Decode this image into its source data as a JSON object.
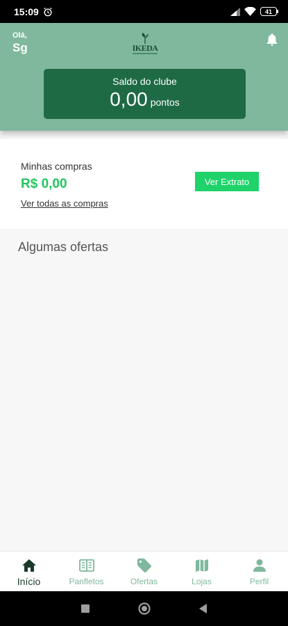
{
  "status_bar": {
    "time": "15:09",
    "battery": "41"
  },
  "header": {
    "greeting": "Olá,",
    "user_name": "Sg",
    "logo_text": "IKEDA",
    "saldo_title": "Saldo do clube",
    "saldo_value": "0,00",
    "saldo_unit": "pontos"
  },
  "purchases": {
    "label": "Minhas compras",
    "amount": "R$ 0,00",
    "see_all": "Ver todas as compras",
    "extrato_button": "Ver Extrato"
  },
  "offers": {
    "title": "Algumas ofertas"
  },
  "bottom_nav": {
    "items": [
      {
        "label": "Início",
        "icon": "home-icon",
        "active": true
      },
      {
        "label": "Panfletos",
        "icon": "newspaper-icon",
        "active": false
      },
      {
        "label": "Ofertas",
        "icon": "tag-icon",
        "active": false
      },
      {
        "label": "Lojas",
        "icon": "map-icon",
        "active": false
      },
      {
        "label": "Perfil",
        "icon": "person-icon",
        "active": false
      }
    ]
  },
  "colors": {
    "header_bg": "#7fb89d",
    "card_bg": "#1e6a44",
    "accent_green": "#22c55e",
    "button_green": "#1fd36a",
    "nav_inactive": "#7fb89d",
    "nav_active": "#1b3a2a"
  }
}
